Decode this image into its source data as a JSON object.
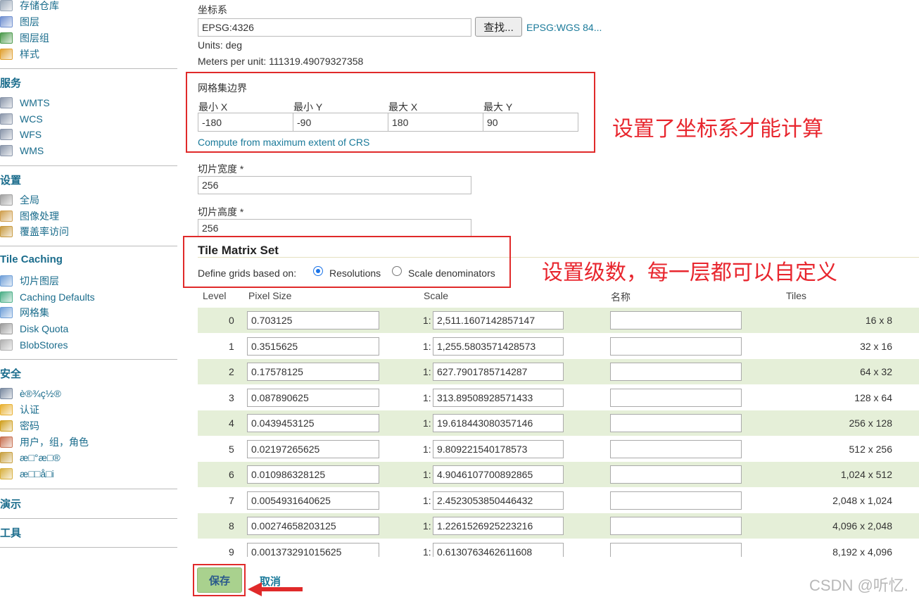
{
  "sidebar": {
    "groups": [
      {
        "head": "",
        "items": [
          {
            "label": "存储仓库",
            "icon": "store-icon"
          },
          {
            "label": "图层",
            "icon": "layer-icon"
          },
          {
            "label": "图层组",
            "icon": "layer-group-icon"
          },
          {
            "label": "样式",
            "icon": "style-icon"
          }
        ]
      },
      {
        "head": "服务",
        "items": [
          {
            "label": "WMTS",
            "icon": "service-icon"
          },
          {
            "label": "WCS",
            "icon": "service-icon"
          },
          {
            "label": "WFS",
            "icon": "service-icon"
          },
          {
            "label": "WMS",
            "icon": "service-icon"
          }
        ]
      },
      {
        "head": "设置",
        "items": [
          {
            "label": "全局",
            "icon": "global-settings-icon"
          },
          {
            "label": "图像处理",
            "icon": "image-processing-icon"
          },
          {
            "label": "覆盖率访问",
            "icon": "coverage-access-icon"
          }
        ]
      },
      {
        "head": "Tile Caching",
        "items": [
          {
            "label": "切片图层",
            "icon": "tile-layers-icon"
          },
          {
            "label": "Caching Defaults",
            "icon": "caching-defaults-icon"
          },
          {
            "label": "网格集",
            "icon": "gridsets-icon"
          },
          {
            "label": "Disk Quota",
            "icon": "disk-quota-icon"
          },
          {
            "label": "BlobStores",
            "icon": "blobstores-icon"
          }
        ]
      },
      {
        "head": "安全",
        "items": [
          {
            "label": "è®¾ç½®",
            "icon": "wrench-icon"
          },
          {
            "label": "认证",
            "icon": "shield-icon"
          },
          {
            "label": "密码",
            "icon": "lock-icon"
          },
          {
            "label": "用户，组，角色",
            "icon": "users-icon"
          },
          {
            "label": "æ□°æ□®",
            "icon": "data-icon"
          },
          {
            "label": "æ□□å□i",
            "icon": "service-security-icon"
          }
        ]
      },
      {
        "head": "演示",
        "items": []
      },
      {
        "head": "工具",
        "items": []
      }
    ]
  },
  "crs": {
    "label": "坐标系",
    "value": "EPSG:4326",
    "find_button": "查找...",
    "link": "EPSG:WGS 84...",
    "units": "Units: deg",
    "meters_per_unit": "Meters per unit: 111319.49079327358"
  },
  "bounds": {
    "label": "网格集边界",
    "headers": [
      "最小 X",
      "最小 Y",
      "最大 X",
      "最大 Y"
    ],
    "values": [
      "-180",
      "-90",
      "180",
      "90"
    ],
    "compute_link": "Compute from maximum extent of CRS"
  },
  "tile_width": {
    "label": "切片宽度 *",
    "value": "256"
  },
  "tile_height": {
    "label": "切片高度 *",
    "value": "256"
  },
  "matrix": {
    "title": "Tile Matrix Set",
    "define_label": "Define grids based on:",
    "opt_resolutions": "Resolutions",
    "opt_scale": "Scale denominators",
    "selected": "Resolutions",
    "headers": {
      "level": "Level",
      "pixel": "Pixel Size",
      "scale": "Scale",
      "name": "名称",
      "tiles": "Tiles"
    },
    "scale_prefix": "1:",
    "rows": [
      {
        "level": "0",
        "pixel": "0.703125",
        "scale": "2,511.1607142857147",
        "name": "",
        "tiles": "16 x 8"
      },
      {
        "level": "1",
        "pixel": "0.3515625",
        "scale": "1,255.5803571428573",
        "name": "",
        "tiles": "32 x 16"
      },
      {
        "level": "2",
        "pixel": "0.17578125",
        "scale": "627.7901785714287",
        "name": "",
        "tiles": "64 x 32"
      },
      {
        "level": "3",
        "pixel": "0.087890625",
        "scale": "313.89508928571433",
        "name": "",
        "tiles": "128 x 64"
      },
      {
        "level": "4",
        "pixel": "0.0439453125",
        "scale": "19.618443080357146",
        "name": "",
        "tiles": "256 x 128"
      },
      {
        "level": "5",
        "pixel": "0.02197265625",
        "scale": "9.809221540178573",
        "name": "",
        "tiles": "512 x 256"
      },
      {
        "level": "6",
        "pixel": "0.010986328125",
        "scale": "4.9046107700892865",
        "name": "",
        "tiles": "1,024 x 512"
      },
      {
        "level": "7",
        "pixel": "0.0054931640625",
        "scale": "2.4523053850446432",
        "name": "",
        "tiles": "2,048 x 1,024"
      },
      {
        "level": "8",
        "pixel": "0.00274658203125",
        "scale": "1.2261526925223216",
        "name": "",
        "tiles": "4,096 x 2,048"
      },
      {
        "level": "9",
        "pixel": "0.001373291015625",
        "scale": "0.6130763462611608",
        "name": "",
        "tiles": "8,192 x 4,096"
      }
    ]
  },
  "buttons": {
    "save": "保存",
    "cancel": "取消"
  },
  "annotations": {
    "bounds_note": "设置了坐标系才能计算",
    "levels_note": "设置级数，每一层都可以自定义"
  },
  "watermark": "CSDN @听忆.",
  "colors": {
    "link": "#1a7a9a",
    "sidebar_link": "#1a6c8c",
    "annotation": "#e8262e",
    "row_alt": "#e5efd8",
    "save_button": "#a9d18e"
  }
}
